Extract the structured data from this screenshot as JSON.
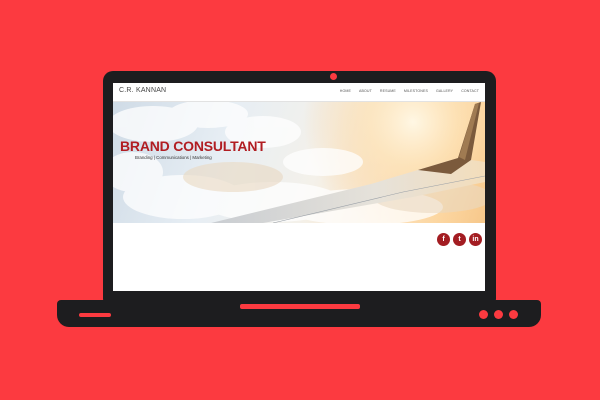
{
  "site": {
    "logo": "C.R. KANNAN"
  },
  "nav": {
    "items": [
      "HOME",
      "ABOUT",
      "RESUME",
      "MILESTONES",
      "GALLERY",
      "CONTACT"
    ]
  },
  "hero": {
    "title": "BRAND CONSULTANT",
    "subtitle": "Branding | Communications | Marketing"
  },
  "social": {
    "facebook": "f",
    "twitter": "t",
    "linkedin": "in"
  },
  "colors": {
    "background": "#fc3a40",
    "laptop": "#1d1d1f",
    "brand_red": "#b11d22",
    "social_red": "#a31d22"
  },
  "icons": [
    "facebook-icon",
    "twitter-icon",
    "linkedin-icon",
    "camera-icon",
    "power-led-icon"
  ]
}
